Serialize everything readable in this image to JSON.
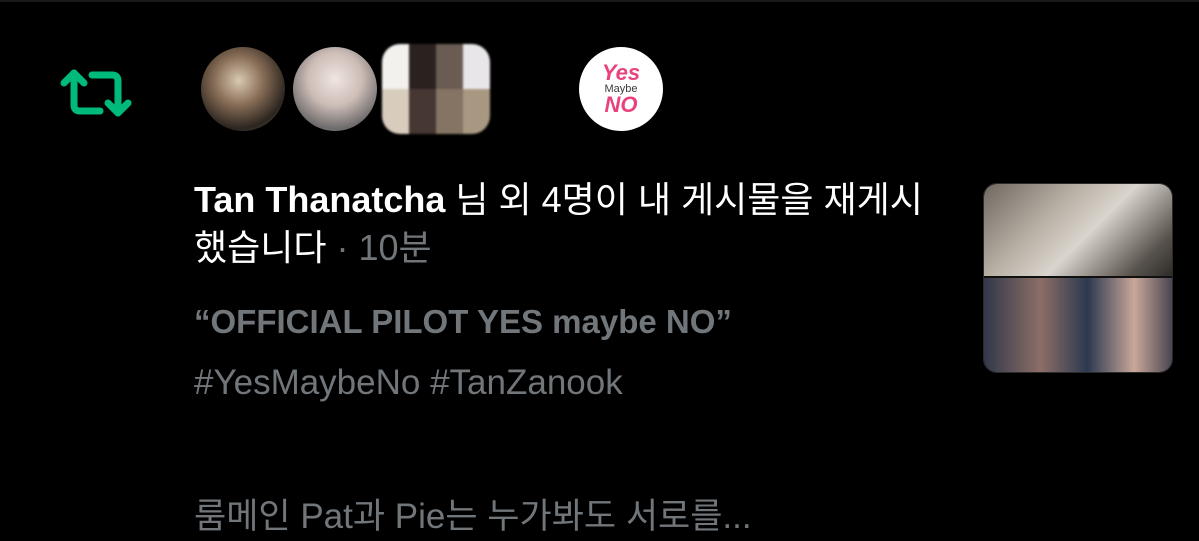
{
  "notification": {
    "name": "Tan Thanatcha",
    "action": " 님 외 4명이 내 게시물을 재게시했습니다",
    "separator": " · ",
    "time": "10분"
  },
  "post": {
    "quote_title": "“OFFICIAL PILOT YES maybe NO”",
    "hashtags": "#YesMaybeNo #TanZanook",
    "preview": "룸메인 Pat과 Pie는 누가봐도 서로를..."
  },
  "avatars": [
    {
      "kind": "profile-photo"
    },
    {
      "kind": "profile-photo"
    },
    {
      "kind": "pixelated-profile"
    },
    {
      "kind": "logo",
      "logo_text": {
        "yes": "Yes",
        "maybe": "Maybe",
        "no": "NO"
      }
    }
  ],
  "colors": {
    "background": "#000000",
    "retweet_green": "#00ba7c",
    "primary_text": "#ffffff",
    "secondary_text": "#71767b",
    "logo_pink": "#e8437f"
  },
  "icons": {
    "retweet": "retweet-icon"
  }
}
